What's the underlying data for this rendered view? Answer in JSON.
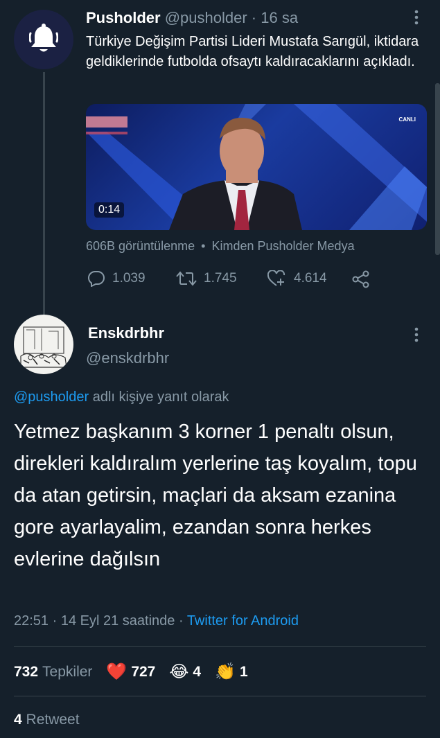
{
  "parent": {
    "name": "Pusholder",
    "handle": "@pusholder",
    "dot": "·",
    "time": "16 sa",
    "text": "Türkiye Değişim Partisi Lideri Mustafa Sarıgül, iktidara geldiklerinde futbolda ofsaytı kaldıracaklarını açıkladı.",
    "video": {
      "badge": "CANLI",
      "duration": "0:14"
    },
    "views": "606B görüntülenme",
    "bullet": "•",
    "source": "Kimden Pusholder Medya",
    "actions": {
      "replies": "1.039",
      "retweets": "1.745",
      "likes": "4.614"
    }
  },
  "reply": {
    "name": "Enskdrbhr",
    "handle": "@enskdrbhr",
    "replying_to_handle": "@pusholder",
    "replying_to_suffix": "adlı kişiye yanıt olarak",
    "text": "Yetmez başkanım 3 korner 1 penaltı olsun, direkleri kaldıralım yerlerine taş koyalım, topu da atan getirsin, maçlari da aksam ezanina gore ayarlayalim, ezandan sonra herkes evlerine dağılsın",
    "time": "22:51 · 14 Eyl 21 saatinde ·",
    "client": "Twitter for Android",
    "reactions": {
      "total": "732",
      "label": "Tepkiler",
      "heart_emoji": "❤️",
      "heart": "727",
      "laugh_emoji": "😂",
      "laugh": "4",
      "clap_emoji": "👏",
      "clap": "1"
    },
    "retweets": {
      "count": "4",
      "label": "Retweet"
    }
  },
  "colors": {
    "background": "#15202b",
    "muted": "#8899a6",
    "link": "#1d9bf0",
    "divider": "#38444d"
  },
  "icons": [
    "bell-icon",
    "more-icon",
    "reply-icon",
    "retweet-icon",
    "like-icon",
    "share-icon"
  ]
}
